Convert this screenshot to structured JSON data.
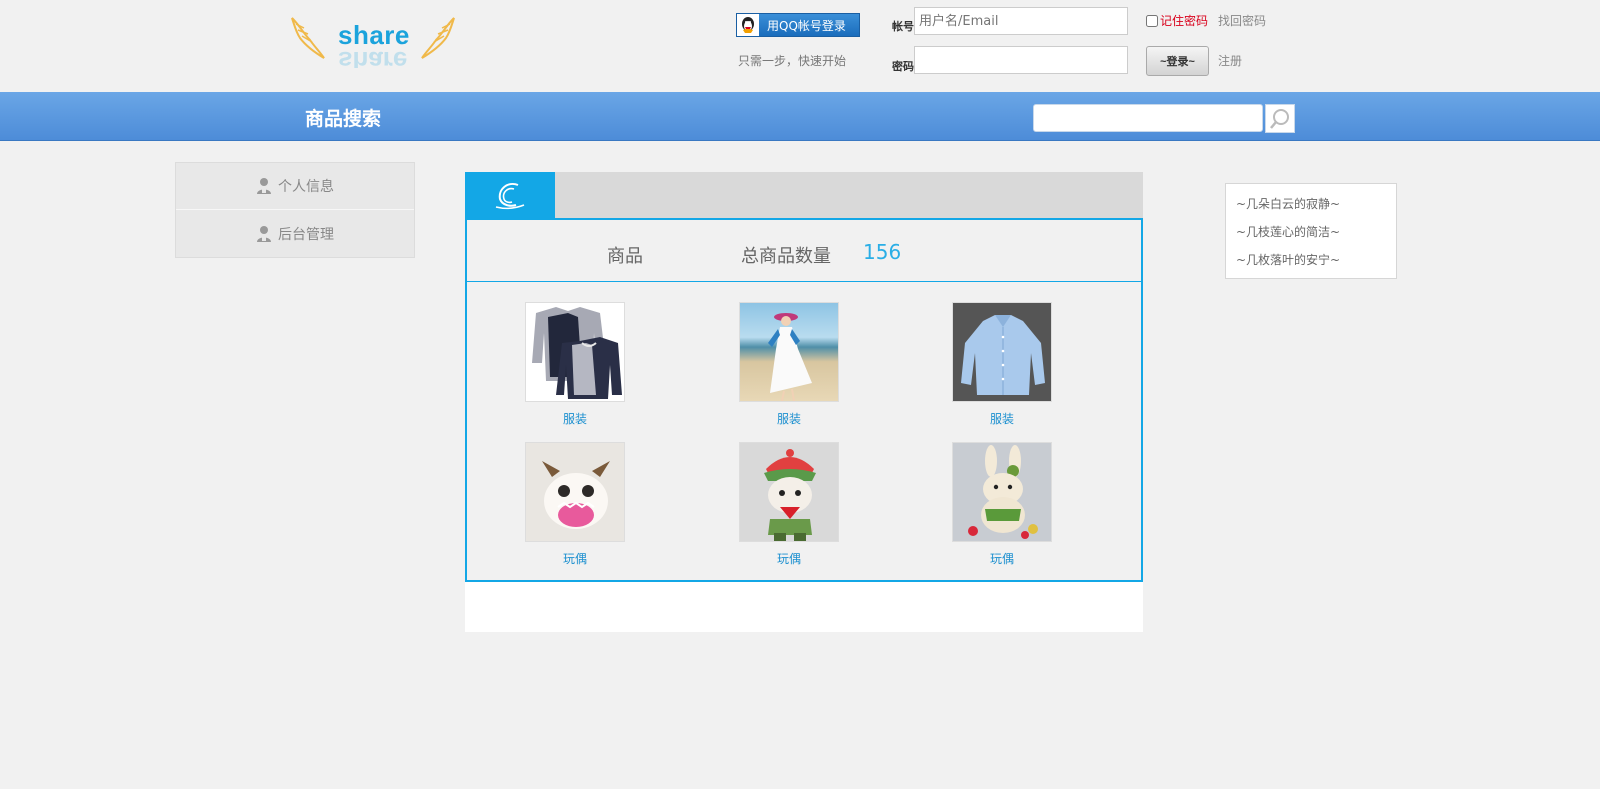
{
  "header": {
    "logo_text": "share",
    "qq_login_label": "用QQ帐号登录",
    "qq_tip": "只需一步，快速开始",
    "account_label": "帐号",
    "account_placeholder": "用户名/Email",
    "password_label": "密码",
    "remember_label": "记住密码",
    "find_password": "找回密码",
    "login_button": "~登录~",
    "register": "注册"
  },
  "search": {
    "title": "商品搜索",
    "placeholder": ""
  },
  "sidebar": {
    "items": [
      {
        "label": "个人信息"
      },
      {
        "label": "后台管理"
      }
    ]
  },
  "main": {
    "stats": {
      "goods_label": "商品",
      "total_label": "总商品数量",
      "total_value": "156"
    },
    "products": [
      {
        "caption": "服装",
        "icon": "sweater-image"
      },
      {
        "caption": "服装",
        "icon": "white-dress-image"
      },
      {
        "caption": "服装",
        "icon": "blue-shirt-image"
      },
      {
        "caption": "玩偶",
        "icon": "poro-doll-image"
      },
      {
        "caption": "玩偶",
        "icon": "teemo-doll-image"
      },
      {
        "caption": "玩偶",
        "icon": "bunny-doll-image"
      }
    ]
  },
  "quotes": [
    "~几朵白云的寂静~",
    "~几枝莲心的简洁~",
    "~几枚落叶的安宁~"
  ],
  "colors": {
    "accent_blue": "#13a7e6",
    "search_bar_blue": "#5b98df",
    "remember_red": "#d9001b",
    "logo_blue": "#1ba3dc"
  }
}
